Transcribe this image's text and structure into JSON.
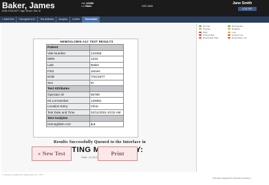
{
  "header": {
    "patient_name": "Baker, James",
    "dob_line": "DOB: 07/21/1977 / Age: 38 yrs / Sex: M",
    "visit_label": "Visit",
    "visit_value": "123456",
    "loc_label": "Loc",
    "loc_value": "Baker",
    "mrn_label": "MRN",
    "mrn_value": "1234",
    "user": "Jane Smith",
    "logoff": "LOG OFF"
  },
  "tabs": [
    "< Admit Test",
    "Hemoglobin A1C",
    "Test Attributes",
    "Analytics",
    "Confirm",
    "Transmitted"
  ],
  "active_tab_index": 5,
  "result_card": {
    "title": "HEMOGLOBIN A1C TEST RESULTS",
    "rows": [
      {
        "label": "Patient",
        "value": "",
        "type": "hdr"
      },
      {
        "label": "Visit Number",
        "value": "123456",
        "type": "row"
      },
      {
        "label": "MRN",
        "value": "1234",
        "type": "row"
      },
      {
        "label": "Last",
        "value": "Baker",
        "type": "row"
      },
      {
        "label": "First",
        "value": "James",
        "type": "row"
      },
      {
        "label": "DOB",
        "value": "7/21/1977",
        "type": "row"
      },
      {
        "label": "Sex",
        "value": "M",
        "type": "row"
      },
      {
        "label": "Test Attributes",
        "value": "",
        "type": "hdr"
      },
      {
        "label": "Operator ID",
        "value": "56789",
        "type": "row"
      },
      {
        "label": "Kit Lot Number",
        "value": "129381",
        "type": "row"
      },
      {
        "label": "Location Entry",
        "value": "Clinic",
        "type": "row"
      },
      {
        "label": "Test Date and Time",
        "value": "02/11/2015 10:02 AM",
        "type": "row"
      },
      {
        "label": "Test Analytes",
        "value": "",
        "type": "hdr"
      },
      {
        "label": "Hemoglobin A1C",
        "value": "4.1",
        "type": "strong"
      }
    ]
  },
  "message": {
    "line1": "Results Successfully Queued to the Interface in",
    "line2": "TESTING MODE ONLY:",
    "date": "Date: 11/12/2015 10:02:15 AM"
  },
  "buttons": {
    "new_test": "« New Test",
    "print": "Print"
  },
  "legend": [
    {
      "label": "Normal",
      "color": "#4caf50"
    },
    {
      "label": "Positive",
      "color": "#e0a030"
    },
    {
      "label": "High",
      "color": "#e04040"
    },
    {
      "label": "Critical High",
      "color": "#c03030"
    },
    {
      "label": "Reportable High",
      "color": "#ff3b3b"
    },
    {
      "label": "Nonreactive",
      "color": "#4caf50"
    },
    {
      "label": "Negative",
      "color": "#e0a030"
    },
    {
      "label": "Low",
      "color": "#e0a030"
    },
    {
      "label": "Critical Low",
      "color": "#e04040"
    },
    {
      "label": "Reportable Low",
      "color": "#ff3b3b"
    }
  ],
  "footer": {
    "left": "© Siemens Healthcare Diagnostics Inc., 2017",
    "right": "Information displayed for illustration purposes o"
  }
}
